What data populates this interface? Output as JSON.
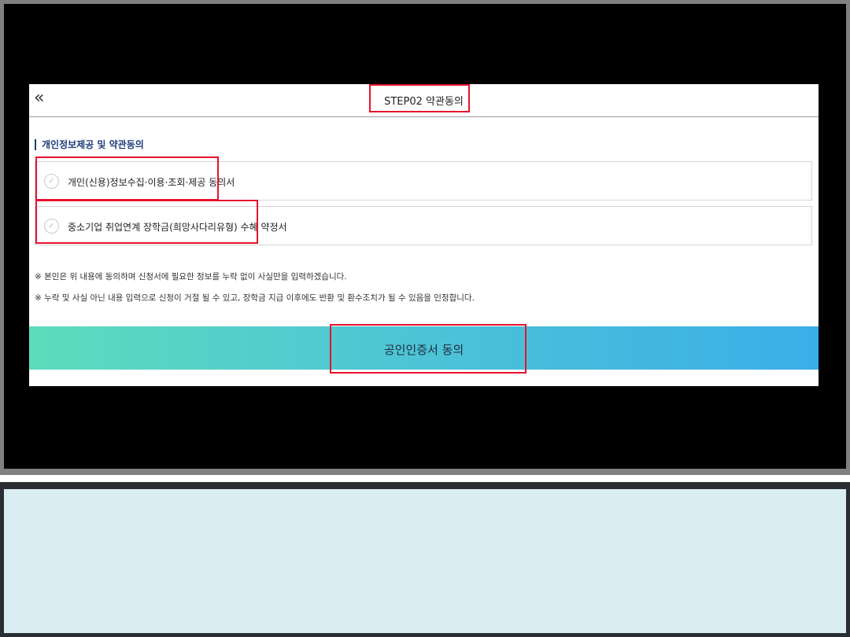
{
  "header": {
    "title": "STEP02 약관동의",
    "back_icon": "double-chevron-left-icon"
  },
  "section": {
    "title": "개인정보제공 및 약관동의"
  },
  "agreements": [
    {
      "label": "개인(신용)정보수집·이용·조회·제공 동의서",
      "icon": "check-circle-icon"
    },
    {
      "label": "중소기업 취업연계 장학금(희망사다리유형) 수혜 약정서",
      "icon": "check-circle-icon"
    }
  ],
  "notes": [
    "※ 본인은 위 내용에 동의하며 신청서에 필요한 정보를 누락 없이 사실만을 입력하겠습니다.",
    "※ 누락 및 사실 아닌 내용 입력으로 신청이 거절 될 수 있고, 장학금 지급 이후에도 반환 및 환수조치가 될 수 있음을 인정합니다."
  ],
  "cta": {
    "label": "공인인증서 동의"
  },
  "colors": {
    "highlight": "#e8112d",
    "section_accent": "#1d3c78",
    "cta_start": "#5ddcbc",
    "cta_end": "#3aaee8",
    "bottom_panel": "#daedf3"
  }
}
